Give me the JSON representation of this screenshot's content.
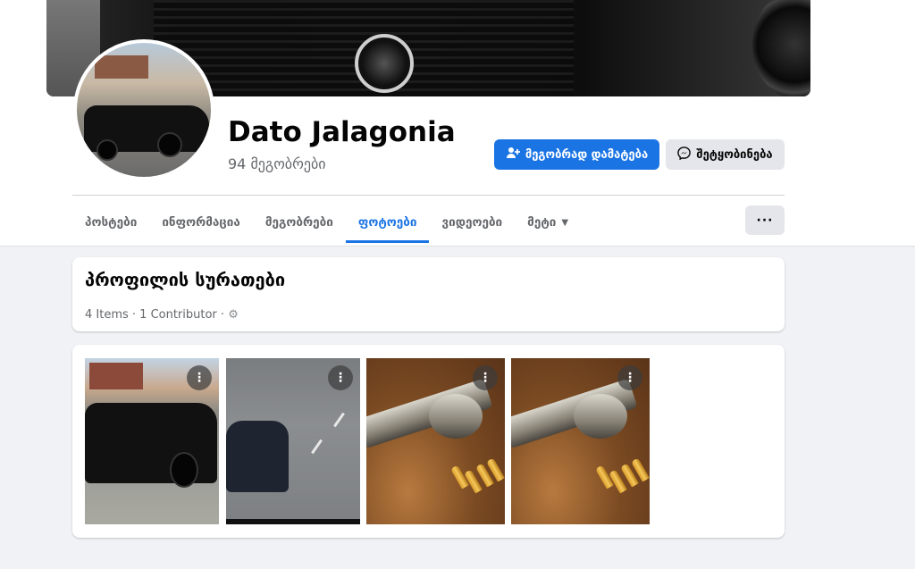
{
  "profile": {
    "name": "Dato Jalagonia",
    "friends_count": "94 მეგობრები"
  },
  "actions": {
    "add_friend": "მეგობრად დამატება",
    "add_friend_icon": "add-friend-icon",
    "message": "შეტყობინება",
    "message_icon": "messenger-icon",
    "more_options": "···"
  },
  "tabs": [
    {
      "label": "პოსტები"
    },
    {
      "label": "ინფორმაცია"
    },
    {
      "label": "მეგობრები"
    },
    {
      "label": "ფოტოები",
      "active": true
    },
    {
      "label": "ვიდეოები"
    },
    {
      "label": "მეტი"
    }
  ],
  "album": {
    "title": "პროფილის სურათები",
    "meta": "4 Items · 1 Contributor ·",
    "settings_icon": "gear-icon"
  },
  "photos": [
    {
      "menu": "⋮"
    },
    {
      "menu": "⋮"
    },
    {
      "menu": "⋮"
    },
    {
      "menu": "⋮"
    }
  ],
  "colors": {
    "accent": "#1b74e4",
    "background": "#f0f2f5"
  }
}
